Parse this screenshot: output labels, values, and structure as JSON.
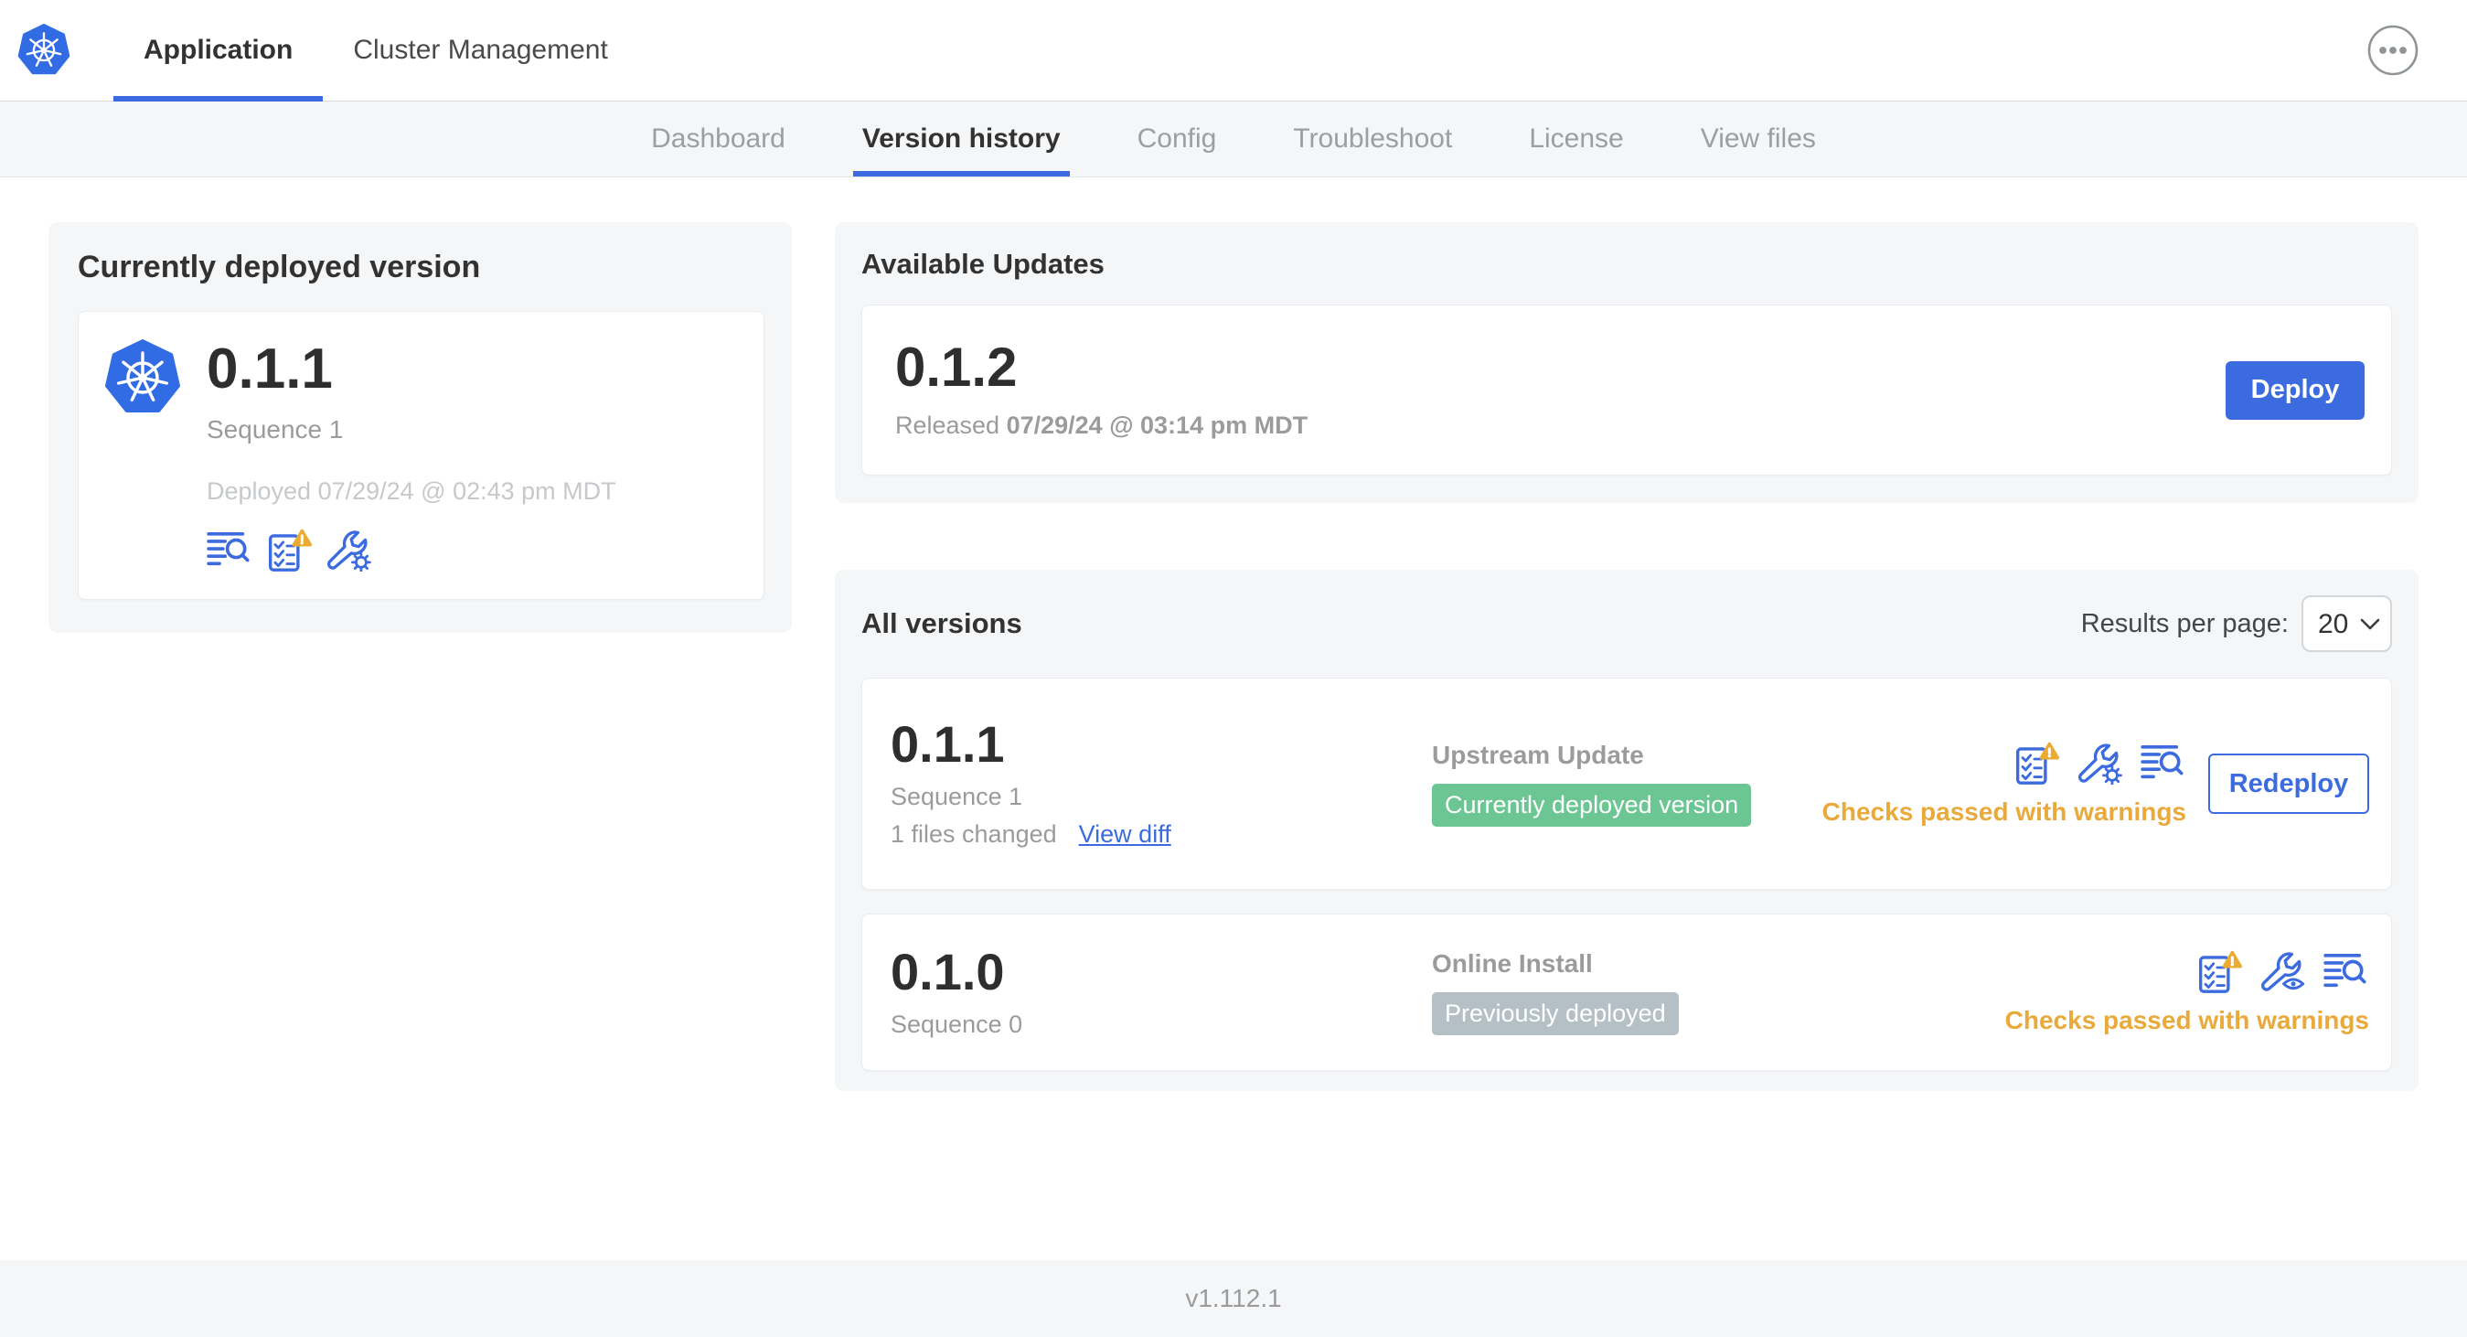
{
  "colors": {
    "primary_blue": "#3b6bde",
    "kubernetes_blue": "#326ce5",
    "warning_amber": "#ebab32",
    "warning_text": "#e9a93b",
    "badge_green": "#6cc694",
    "badge_gray": "#b4c0c6",
    "text_dark": "#323232",
    "text_gray": "#9b9b9b",
    "text_faint": "#c6c9cc"
  },
  "header": {
    "tabs": [
      {
        "label": "Application",
        "active": true
      },
      {
        "label": "Cluster Management",
        "active": false
      }
    ],
    "menu_icon": "ellipsis-menu-icon"
  },
  "nav": {
    "items": [
      {
        "label": "Dashboard",
        "active": false
      },
      {
        "label": "Version history",
        "active": true
      },
      {
        "label": "Config",
        "active": false
      },
      {
        "label": "Troubleshoot",
        "active": false
      },
      {
        "label": "License",
        "active": false
      },
      {
        "label": "View files",
        "active": false
      }
    ]
  },
  "current_version": {
    "title": "Currently deployed version",
    "version": "0.1.1",
    "sequence": "Sequence 1",
    "deployed": "Deployed 07/29/24 @ 02:43 pm MDT",
    "icons": [
      "logs-icon",
      "preflight-checks-warning-icon",
      "edit-config-icon"
    ]
  },
  "available_updates": {
    "title": "Available Updates",
    "version": "0.1.2",
    "released_label": "Released",
    "released_datetime": "07/29/24 @ 03:14 pm MDT",
    "deploy_button": "Deploy"
  },
  "all_versions": {
    "title": "All versions",
    "results_per_page_label": "Results per page:",
    "results_per_page_value": "20",
    "rows": [
      {
        "version": "0.1.1",
        "sequence": "Sequence 1",
        "files_changed": "1 files changed",
        "view_diff_link": "View diff",
        "source": "Upstream Update",
        "badge": "Currently deployed version",
        "badge_color": "green",
        "status": "Checks passed with warnings",
        "action_button": "Redeploy",
        "icons": [
          "preflight-checks-warning-icon",
          "edit-config-icon",
          "logs-icon"
        ]
      },
      {
        "version": "0.1.0",
        "sequence": "Sequence 0",
        "source": "Online Install",
        "badge": "Previously deployed",
        "badge_color": "gray",
        "status": "Checks passed with warnings",
        "icons": [
          "preflight-checks-warning-icon",
          "view-config-icon",
          "logs-icon"
        ]
      }
    ]
  },
  "footer": {
    "version_label": "v1.112.1"
  }
}
